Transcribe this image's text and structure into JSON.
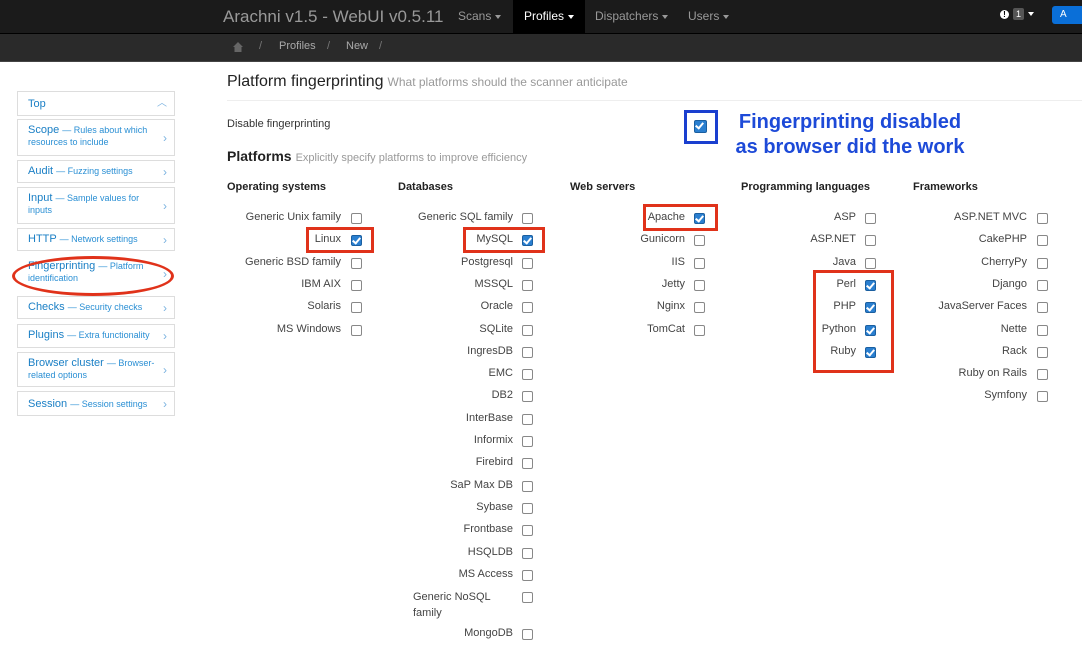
{
  "navbar": {
    "brand": "Arachni v1.5 - WebUI v0.5.11",
    "items": [
      {
        "label": "Scans"
      },
      {
        "label": "Profiles"
      },
      {
        "label": "Dispatchers"
      },
      {
        "label": "Users"
      }
    ],
    "notification_count": "1",
    "user_button": "A"
  },
  "breadcrumb": {
    "items": [
      "Profiles",
      "New"
    ]
  },
  "sidebar": {
    "items": [
      {
        "label": "Top",
        "sub": ""
      },
      {
        "label": "Scope",
        "sub": "— Rules about which resources to include"
      },
      {
        "label": "Audit",
        "sub": "— Fuzzing settings"
      },
      {
        "label": "Input",
        "sub": "— Sample values for inputs"
      },
      {
        "label": "HTTP",
        "sub": "— Network settings"
      },
      {
        "label": "Fingerprinting",
        "sub": "— Platform identification"
      },
      {
        "label": "Checks",
        "sub": "— Security checks"
      },
      {
        "label": "Plugins",
        "sub": "— Extra functionality"
      },
      {
        "label": "Browser cluster",
        "sub": "— Browser-related options"
      },
      {
        "label": "Session",
        "sub": "— Session settings"
      }
    ]
  },
  "main": {
    "title": "Platform fingerprinting",
    "subtitle": "What platforms should the scanner anticipate",
    "disable_label": "Disable fingerprinting",
    "disable_checked": true,
    "platforms_title": "Platforms",
    "platforms_subtitle": "Explicitly specify platforms to improve efficiency"
  },
  "annotation": {
    "line1": "Fingerprinting disabled",
    "line2": "as browser did the work"
  },
  "columns": [
    {
      "header": "Operating systems",
      "options": [
        {
          "label": "Generic Unix family",
          "checked": false
        },
        {
          "label": "Linux",
          "checked": true
        },
        {
          "label": "Generic BSD family",
          "checked": false
        },
        {
          "label": "IBM AIX",
          "checked": false
        },
        {
          "label": "Solaris",
          "checked": false
        },
        {
          "label": "MS Windows",
          "checked": false
        }
      ]
    },
    {
      "header": "Databases",
      "options": [
        {
          "label": "Generic SQL family",
          "checked": false
        },
        {
          "label": "MySQL",
          "checked": true
        },
        {
          "label": "Postgresql",
          "checked": false
        },
        {
          "label": "MSSQL",
          "checked": false
        },
        {
          "label": "Oracle",
          "checked": false
        },
        {
          "label": "SQLite",
          "checked": false
        },
        {
          "label": "IngresDB",
          "checked": false
        },
        {
          "label": "EMC",
          "checked": false
        },
        {
          "label": "DB2",
          "checked": false
        },
        {
          "label": "InterBase",
          "checked": false
        },
        {
          "label": "Informix",
          "checked": false
        },
        {
          "label": "Firebird",
          "checked": false
        },
        {
          "label": "SaP Max DB",
          "checked": false
        },
        {
          "label": "Sybase",
          "checked": false
        },
        {
          "label": "Frontbase",
          "checked": false
        },
        {
          "label": "HSQLDB",
          "checked": false
        },
        {
          "label": "MS Access",
          "checked": false
        },
        {
          "label": "Generic NoSQL family",
          "checked": false
        },
        {
          "label": "MongoDB",
          "checked": false
        }
      ]
    },
    {
      "header": "Web servers",
      "options": [
        {
          "label": "Apache",
          "checked": true
        },
        {
          "label": "Gunicorn",
          "checked": false
        },
        {
          "label": "IIS",
          "checked": false
        },
        {
          "label": "Jetty",
          "checked": false
        },
        {
          "label": "Nginx",
          "checked": false
        },
        {
          "label": "TomCat",
          "checked": false
        }
      ]
    },
    {
      "header": "Programming languages",
      "options": [
        {
          "label": "ASP",
          "checked": false
        },
        {
          "label": "ASP.NET",
          "checked": false
        },
        {
          "label": "Java",
          "checked": false
        },
        {
          "label": "Perl",
          "checked": true
        },
        {
          "label": "PHP",
          "checked": true
        },
        {
          "label": "Python",
          "checked": true
        },
        {
          "label": "Ruby",
          "checked": true
        }
      ]
    },
    {
      "header": "Frameworks",
      "options": [
        {
          "label": "ASP.NET MVC",
          "checked": false
        },
        {
          "label": "CakePHP",
          "checked": false
        },
        {
          "label": "CherryPy",
          "checked": false
        },
        {
          "label": "Django",
          "checked": false
        },
        {
          "label": "JavaServer Faces",
          "checked": false
        },
        {
          "label": "Nette",
          "checked": false
        },
        {
          "label": "Rack",
          "checked": false
        },
        {
          "label": "Ruby on Rails",
          "checked": false
        },
        {
          "label": "Symfony",
          "checked": false
        }
      ]
    }
  ],
  "colors": {
    "accent": "#1a7fc5",
    "annotation_red": "#e0321a",
    "annotation_blue": "#1d4ad8"
  }
}
